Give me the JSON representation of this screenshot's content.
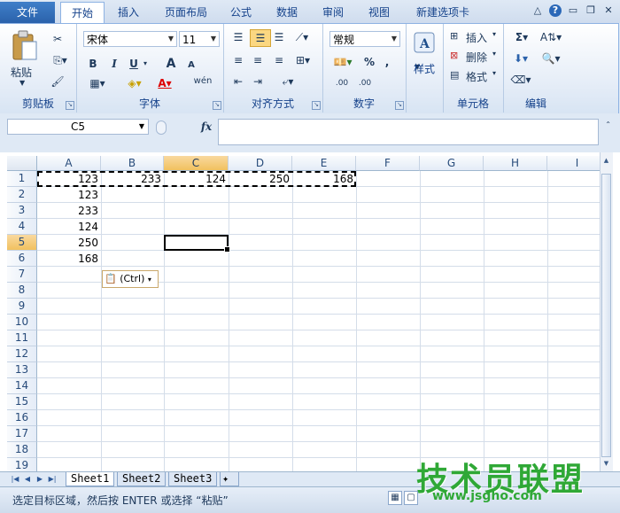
{
  "tabs": {
    "file": "文件",
    "items": [
      "开始",
      "插入",
      "页面布局",
      "公式",
      "数据",
      "审阅",
      "视图",
      "新建选项卡"
    ]
  },
  "ribbon": {
    "clipboard": {
      "paste": "粘贴",
      "label": "剪贴板"
    },
    "font": {
      "name": "宋体",
      "size": "11",
      "bold": "B",
      "italic": "I",
      "underline": "U",
      "grow": "A",
      "shrink": "A",
      "label": "字体",
      "wen": "wén"
    },
    "alignment": {
      "label": "对齐方式"
    },
    "number": {
      "format": "常规",
      "percent": "%",
      "comma": ",",
      "label": "数字",
      "inc": ".00",
      "dec": ".00"
    },
    "styles": {
      "label": "样式"
    },
    "cells": {
      "insert": "插入",
      "delete": "删除",
      "format": "格式",
      "label": "单元格"
    },
    "editing": {
      "sigma": "Σ",
      "label": "编辑"
    }
  },
  "formula_bar": {
    "name_box": "C5",
    "fx": "fx",
    "value": ""
  },
  "columns": [
    "A",
    "B",
    "C",
    "D",
    "E",
    "F",
    "G",
    "H",
    "I"
  ],
  "rows": [
    "1",
    "2",
    "3",
    "4",
    "5",
    "6",
    "7",
    "8",
    "9",
    "10",
    "11",
    "12",
    "13",
    "14",
    "15",
    "16",
    "17",
    "18",
    "19"
  ],
  "cells": {
    "A1": "123",
    "B1": "233",
    "C1": "124",
    "D1": "250",
    "E1": "168",
    "A2": "123",
    "A3": "233",
    "A4": "124",
    "A5": "250",
    "A6": "168"
  },
  "paste_options": "(Ctrl)",
  "sheets": [
    "Sheet1",
    "Sheet2",
    "Sheet3"
  ],
  "status": {
    "message": "选定目标区域，然后按 ENTER 或选择 “粘贴”"
  },
  "watermark": {
    "line1": "技术员联盟",
    "line2": "www.jsgho.com"
  }
}
